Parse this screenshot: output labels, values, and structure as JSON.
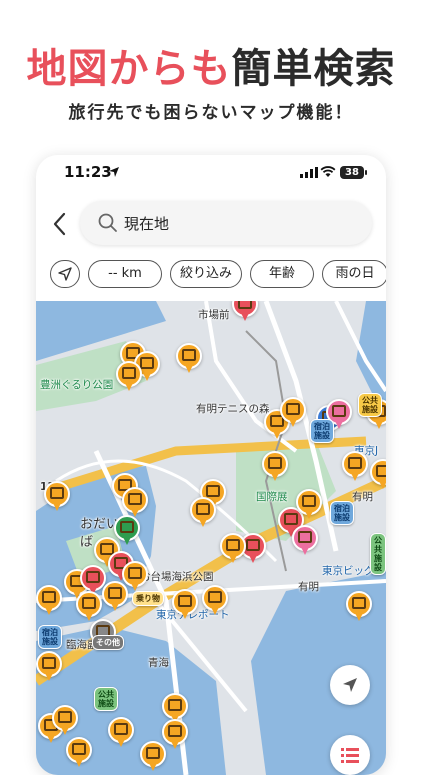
{
  "headline": {
    "accent": "地図からも",
    "dark": "簡単検索"
  },
  "subhead": "旅行先でも困らないマップ機能！",
  "status": {
    "time": "11:23",
    "battery": "38"
  },
  "search": {
    "text": "現在地"
  },
  "filters": [
    {
      "label": "-- km"
    },
    {
      "label": "絞り込み"
    },
    {
      "label": "年齢"
    },
    {
      "label": "雨の日"
    }
  ],
  "map": {
    "labels": {
      "ichiba": "市場前",
      "toyosu_park": "豊洲ぐるり公園",
      "ariake_tennis": "有明テニスの森",
      "kokusai": "国際展",
      "ariake": "有明",
      "ariake2": "有明",
      "odaiba": "おだい",
      "ba": "ば",
      "odaiba_park": "お台場海浜公園",
      "tokyo_teleport": "東京テレポート",
      "aomi": "青海",
      "tokyo_big": "東京ビッグ",
      "rinkai": "臨海副",
      "tokyo_j": "東京J",
      "route11": "11"
    },
    "tags": {
      "shukuhaku1": "宿泊\n施設",
      "shukuhaku2": "宿泊\n施設",
      "shukuhaku3": "宿泊\n施設",
      "kokyo1": "公共\n施設",
      "kokyo2": "公共\n施設",
      "kokyo3": "公共\n施設",
      "norimono": "乗り物",
      "sonota": "その他"
    }
  },
  "colors": {
    "accent": "#e8505b",
    "pin": "#f5a623",
    "water": "#8eb8e0",
    "land": "#dfe3e8",
    "park": "#bfe0c5"
  }
}
